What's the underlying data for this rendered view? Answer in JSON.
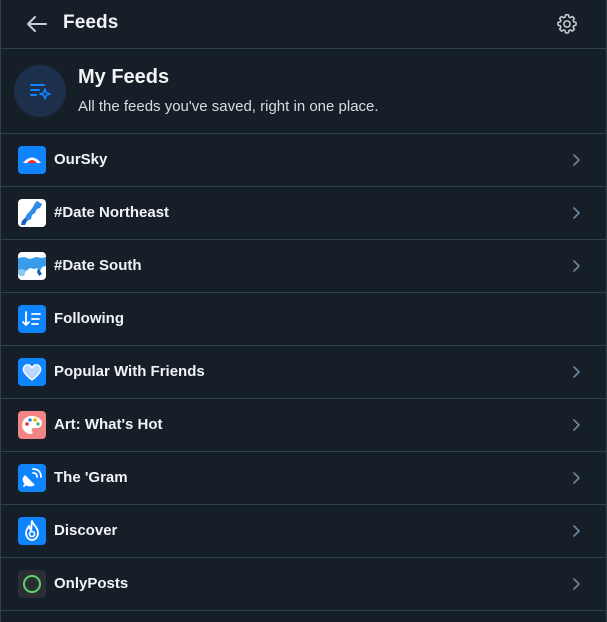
{
  "header": {
    "title": "Feeds"
  },
  "hero": {
    "title": "My Feeds",
    "subtitle": "All the feeds you've saved, right in one place."
  },
  "feeds": [
    {
      "name": "OurSky",
      "icon": "oursky-logo",
      "chevron": true
    },
    {
      "name": "#Date Northeast",
      "icon": "northeast-map-icon",
      "chevron": true
    },
    {
      "name": "#Date South",
      "icon": "south-map-icon",
      "chevron": true
    },
    {
      "name": "Following",
      "icon": "sort-list-icon",
      "chevron": false
    },
    {
      "name": "Popular With Friends",
      "icon": "heart-icon",
      "chevron": true
    },
    {
      "name": "Art: What's Hot",
      "icon": "palette-icon",
      "chevron": true
    },
    {
      "name": "The 'Gram",
      "icon": "satellite-icon",
      "chevron": true
    },
    {
      "name": "Discover",
      "icon": "flame-icon",
      "chevron": true
    },
    {
      "name": "OnlyPosts",
      "icon": "circle-icon",
      "chevron": true
    }
  ],
  "colors": {
    "background": "#161e27",
    "border": "#2e4052",
    "accent": "#1083fe",
    "hero_circle": "#1c2f4b"
  }
}
